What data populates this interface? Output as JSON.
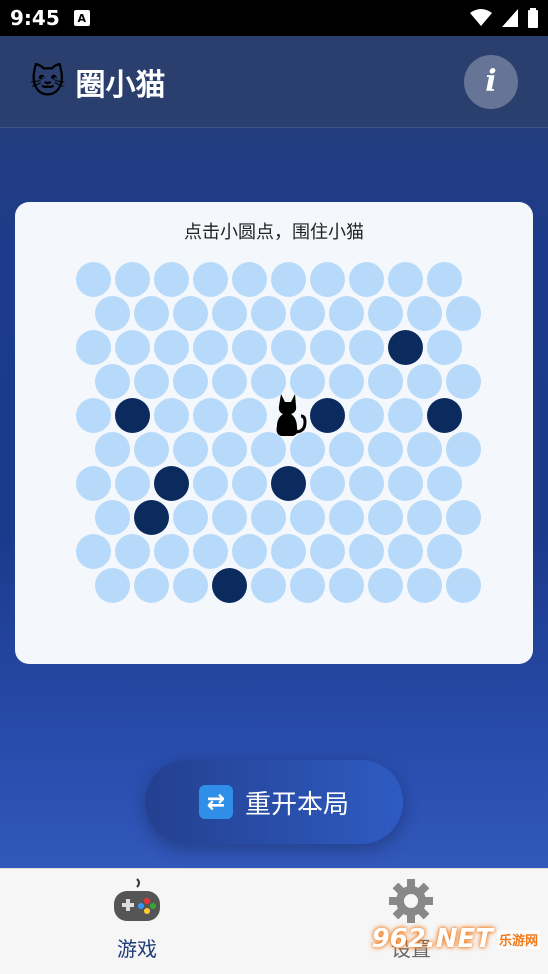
{
  "status_bar": {
    "time": "9:45",
    "notification_icon": "A"
  },
  "app_bar": {
    "icon": "cat-face-emoji",
    "icon_glyph": "🐱",
    "title": "圈小猫",
    "info_label": "i"
  },
  "board": {
    "hint": "点击小圆点，围住小猫",
    "rows": [
      "..........",
      "..........",
      "........X.",
      "..........",
      ".X...CX..X",
      "..........",
      "..X..X....",
      ".X........",
      "..........",
      "...X......"
    ],
    "colors": {
      "empty": "#b7dafa",
      "blocked": "#0b2b5e",
      "card": "#f4f7fb"
    }
  },
  "restart_button": {
    "icon": "refresh-icon",
    "label": "重开本局"
  },
  "bottom_nav": {
    "items": [
      {
        "label": "游戏",
        "icon": "gamepad-icon",
        "active": true
      },
      {
        "label": "设置",
        "icon": "gear-icon",
        "active": false
      }
    ]
  },
  "watermark": {
    "text": "962.NET",
    "sub": "乐游网"
  }
}
